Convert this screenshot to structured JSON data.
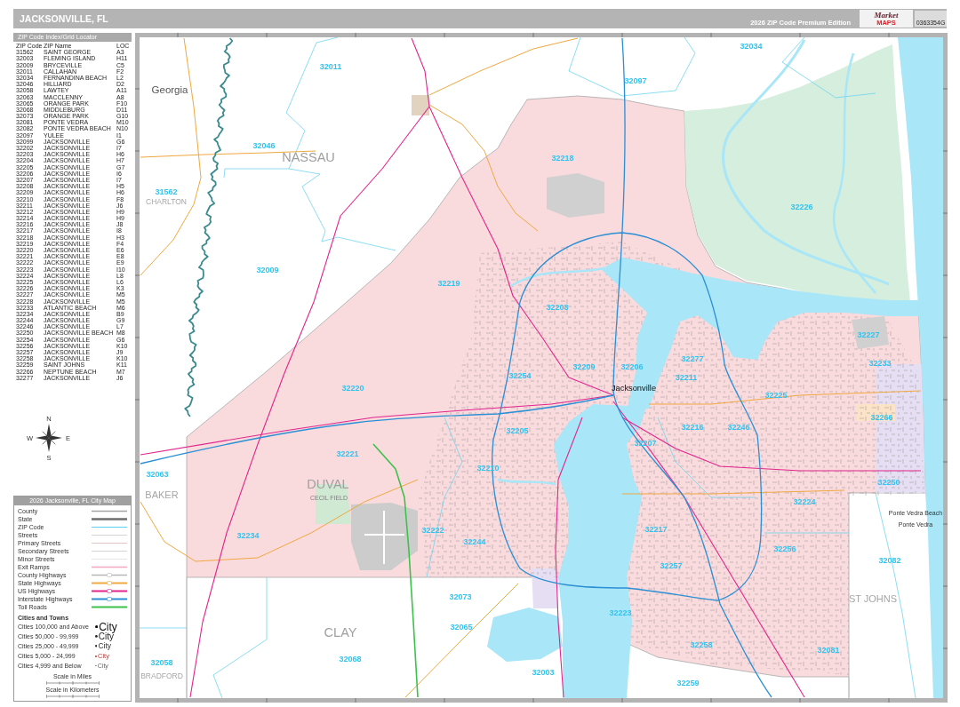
{
  "header": {
    "title": "JACKSONVILLE, FL",
    "edition": "2026 ZIP Code Premium Edition",
    "logo": {
      "word": "Market",
      "accent": "MAPS"
    },
    "code": "0363354G"
  },
  "index": {
    "title": "ZIP Code Index/Grid Locator",
    "columns": [
      "ZIP Code",
      "ZIP Name",
      "LOC"
    ],
    "rows": [
      {
        "zip": "31562",
        "name": "SAINT GEORGE",
        "loc": "A3"
      },
      {
        "zip": "32003",
        "name": "FLEMING ISLAND",
        "loc": "H11"
      },
      {
        "zip": "32009",
        "name": "BRYCEVILLE",
        "loc": "C5"
      },
      {
        "zip": "32011",
        "name": "CALLAHAN",
        "loc": "F2"
      },
      {
        "zip": "32034",
        "name": "FERNANDINA BEACH",
        "loc": "L2"
      },
      {
        "zip": "32046",
        "name": "HILLIARD",
        "loc": "D2"
      },
      {
        "zip": "32058",
        "name": "LAWTEY",
        "loc": "A11"
      },
      {
        "zip": "32063",
        "name": "MACCLENNY",
        "loc": "A8"
      },
      {
        "zip": "32065",
        "name": "ORANGE PARK",
        "loc": "F10"
      },
      {
        "zip": "32068",
        "name": "MIDDLEBURG",
        "loc": "D11"
      },
      {
        "zip": "32073",
        "name": "ORANGE PARK",
        "loc": "G10"
      },
      {
        "zip": "32081",
        "name": "PONTE VEDRA",
        "loc": "M10"
      },
      {
        "zip": "32082",
        "name": "PONTE VEDRA BEACH",
        "loc": "N10"
      },
      {
        "zip": "32097",
        "name": "YULEE",
        "loc": "I1"
      },
      {
        "zip": "32099",
        "name": "JACKSONVILLE",
        "loc": "G6"
      },
      {
        "zip": "32202",
        "name": "JACKSONVILLE",
        "loc": "I7"
      },
      {
        "zip": "32203",
        "name": "JACKSONVILLE",
        "loc": "H6"
      },
      {
        "zip": "32204",
        "name": "JACKSONVILLE",
        "loc": "H7"
      },
      {
        "zip": "32205",
        "name": "JACKSONVILLE",
        "loc": "G7"
      },
      {
        "zip": "32206",
        "name": "JACKSONVILLE",
        "loc": "I6"
      },
      {
        "zip": "32207",
        "name": "JACKSONVILLE",
        "loc": "I7"
      },
      {
        "zip": "32208",
        "name": "JACKSONVILLE",
        "loc": "H5"
      },
      {
        "zip": "32209",
        "name": "JACKSONVILLE",
        "loc": "H6"
      },
      {
        "zip": "32210",
        "name": "JACKSONVILLE",
        "loc": "F8"
      },
      {
        "zip": "32211",
        "name": "JACKSONVILLE",
        "loc": "J6"
      },
      {
        "zip": "32212",
        "name": "JACKSONVILLE",
        "loc": "H9"
      },
      {
        "zip": "32214",
        "name": "JACKSONVILLE",
        "loc": "H9"
      },
      {
        "zip": "32216",
        "name": "JACKSONVILLE",
        "loc": "J8"
      },
      {
        "zip": "32217",
        "name": "JACKSONVILLE",
        "loc": "I8"
      },
      {
        "zip": "32218",
        "name": "JACKSONVILLE",
        "loc": "H3"
      },
      {
        "zip": "32219",
        "name": "JACKSONVILLE",
        "loc": "F4"
      },
      {
        "zip": "32220",
        "name": "JACKSONVILLE",
        "loc": "E6"
      },
      {
        "zip": "32221",
        "name": "JACKSONVILLE",
        "loc": "E8"
      },
      {
        "zip": "32222",
        "name": "JACKSONVILLE",
        "loc": "E9"
      },
      {
        "zip": "32223",
        "name": "JACKSONVILLE",
        "loc": "I10"
      },
      {
        "zip": "32224",
        "name": "JACKSONVILLE",
        "loc": "L8"
      },
      {
        "zip": "32225",
        "name": "JACKSONVILLE",
        "loc": "L6"
      },
      {
        "zip": "32226",
        "name": "JACKSONVILLE",
        "loc": "K3"
      },
      {
        "zip": "32227",
        "name": "JACKSONVILLE",
        "loc": "M5"
      },
      {
        "zip": "32228",
        "name": "JACKSONVILLE",
        "loc": "M5"
      },
      {
        "zip": "32233",
        "name": "ATLANTIC BEACH",
        "loc": "M6"
      },
      {
        "zip": "32234",
        "name": "JACKSONVILLE",
        "loc": "B9"
      },
      {
        "zip": "32244",
        "name": "JACKSONVILLE",
        "loc": "G9"
      },
      {
        "zip": "32246",
        "name": "JACKSONVILLE",
        "loc": "L7"
      },
      {
        "zip": "32250",
        "name": "JACKSONVILLE BEACH",
        "loc": "M8"
      },
      {
        "zip": "32254",
        "name": "JACKSONVILLE",
        "loc": "G6"
      },
      {
        "zip": "32256",
        "name": "JACKSONVILLE",
        "loc": "K10"
      },
      {
        "zip": "32257",
        "name": "JACKSONVILLE",
        "loc": "J9"
      },
      {
        "zip": "32258",
        "name": "JACKSONVILLE",
        "loc": "K10"
      },
      {
        "zip": "32259",
        "name": "SAINT JOHNS",
        "loc": "K11"
      },
      {
        "zip": "32266",
        "name": "NEPTUNE BEACH",
        "loc": "M7"
      },
      {
        "zip": "32277",
        "name": "JACKSONVILLE",
        "loc": "J6"
      }
    ]
  },
  "compass": {
    "letters": [
      "N",
      "E",
      "S",
      "W"
    ]
  },
  "legend": {
    "title": "2026 Jacksonville, FL City Map",
    "lines": [
      {
        "label": "County",
        "kind": "county"
      },
      {
        "label": "State",
        "kind": "state"
      },
      {
        "label": "ZIP Code",
        "kind": "zip"
      },
      {
        "label": "Streets",
        "kind": "street"
      },
      {
        "label": "Primary Streets",
        "kind": "primary"
      },
      {
        "label": "Secondary Streets",
        "kind": "secondary"
      },
      {
        "label": "Minor Streets",
        "kind": "minor"
      },
      {
        "label": "Exit Ramps",
        "kind": "ramp"
      },
      {
        "label": "County Highways",
        "kind": "county_highway"
      },
      {
        "label": "State Highways",
        "kind": "state_highway"
      },
      {
        "label": "US Highways",
        "kind": "us_highway"
      },
      {
        "label": "Interstate Highways",
        "kind": "interstate"
      },
      {
        "label": "Toll Roads",
        "kind": "toll"
      }
    ],
    "cities_title": "Cities and Towns",
    "cities": [
      {
        "label": "Cities 100,000 and Above",
        "sample": "City",
        "kind": "major"
      },
      {
        "label": "Cities 50,000 - 99,999",
        "sample": "City",
        "kind": "large"
      },
      {
        "label": "Cities 25,000 - 49,999",
        "sample": "City",
        "kind": "medium"
      },
      {
        "label": "Cities 5,000 - 24,999",
        "sample": "City",
        "kind": "small"
      },
      {
        "label": "Cities 4,999 and Below",
        "sample": "City",
        "kind": "town"
      }
    ],
    "scales": [
      "Scale in Miles",
      "Scale in Kilometers"
    ]
  },
  "map": {
    "labels": [
      {
        "text": "32034",
        "kind": "zip"
      },
      {
        "text": "32097",
        "kind": "zip"
      },
      {
        "text": "32011",
        "kind": "zip"
      },
      {
        "text": "Georgia",
        "kind": "state"
      },
      {
        "text": "32046",
        "kind": "zip"
      },
      {
        "text": "NASSAU",
        "kind": "county"
      },
      {
        "text": "32218",
        "kind": "zip"
      },
      {
        "text": "31562",
        "kind": "zip"
      },
      {
        "text": "CHARLTON",
        "kind": "edge"
      },
      {
        "text": "32226",
        "kind": "zip"
      },
      {
        "text": "32009",
        "kind": "zip"
      },
      {
        "text": "32219",
        "kind": "zip"
      },
      {
        "text": "32208",
        "kind": "zip"
      },
      {
        "text": "32227",
        "kind": "zip"
      },
      {
        "text": "32233",
        "kind": "zip"
      },
      {
        "text": "32277",
        "kind": "zip"
      },
      {
        "text": "32209",
        "kind": "zip"
      },
      {
        "text": "32206",
        "kind": "zip"
      },
      {
        "text": "32254",
        "kind": "zip"
      },
      {
        "text": "32211",
        "kind": "zip"
      },
      {
        "text": "32220",
        "kind": "zip"
      },
      {
        "text": "Jacksonville",
        "kind": "city"
      },
      {
        "text": "32225",
        "kind": "zip"
      },
      {
        "text": "32266",
        "kind": "zip"
      },
      {
        "text": "32216",
        "kind": "zip"
      },
      {
        "text": "32246",
        "kind": "zip"
      },
      {
        "text": "32205",
        "kind": "zip"
      },
      {
        "text": "32207",
        "kind": "zip"
      },
      {
        "text": "32221",
        "kind": "zip"
      },
      {
        "text": "32210",
        "kind": "zip"
      },
      {
        "text": "32063",
        "kind": "zip"
      },
      {
        "text": "32250",
        "kind": "zip"
      },
      {
        "text": "DUVAL",
        "kind": "county"
      },
      {
        "text": "CECIL FIELD",
        "kind": "facility"
      },
      {
        "text": "BAKER",
        "kind": "neighbor"
      },
      {
        "text": "32224",
        "kind": "zip"
      },
      {
        "text": "Ponte Vedra Beach",
        "kind": "place"
      },
      {
        "text": "Ponte Vedra",
        "kind": "place"
      },
      {
        "text": "32217",
        "kind": "zip"
      },
      {
        "text": "32222",
        "kind": "zip"
      },
      {
        "text": "32234",
        "kind": "zip"
      },
      {
        "text": "32244",
        "kind": "zip"
      },
      {
        "text": "32256",
        "kind": "zip"
      },
      {
        "text": "32082",
        "kind": "zip"
      },
      {
        "text": "32257",
        "kind": "zip"
      },
      {
        "text": "32073",
        "kind": "zip"
      },
      {
        "text": "ST JOHNS",
        "kind": "neighbor"
      },
      {
        "text": "32223",
        "kind": "zip"
      },
      {
        "text": "32065",
        "kind": "zip"
      },
      {
        "text": "CLAY",
        "kind": "county"
      },
      {
        "text": "32258",
        "kind": "zip"
      },
      {
        "text": "32081",
        "kind": "zip"
      },
      {
        "text": "32068",
        "kind": "zip"
      },
      {
        "text": "32058",
        "kind": "zip"
      },
      {
        "text": "BRADFORD",
        "kind": "edge"
      },
      {
        "text": "32003",
        "kind": "zip"
      },
      {
        "text": "32259",
        "kind": "zip"
      }
    ]
  }
}
